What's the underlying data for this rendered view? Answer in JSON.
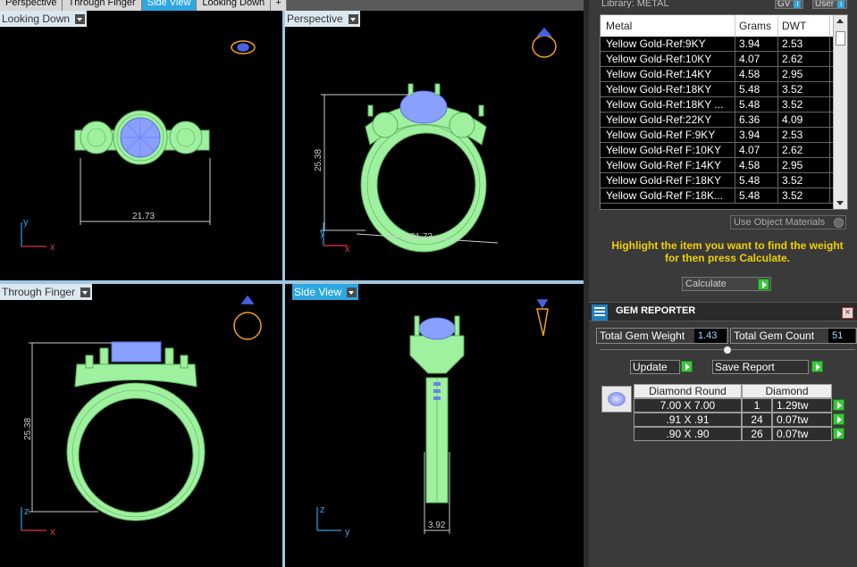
{
  "tabs": [
    {
      "label": "Perspective",
      "active": false
    },
    {
      "label": "Through Finger",
      "active": false
    },
    {
      "label": "Side View",
      "active": true
    },
    {
      "label": "Looking Down",
      "active": false
    },
    {
      "label": "+",
      "active": false
    }
  ],
  "viewports": {
    "top_left": {
      "label": "Looking Down",
      "dimension": "21.73",
      "axis_v": "y",
      "axis_h": "x"
    },
    "top_right": {
      "label": "Perspective",
      "dim_height": "25.38",
      "dim_width": "21.73",
      "axis_v": "y",
      "axis_h": "x"
    },
    "bottom_left": {
      "label": "Through Finger",
      "dimension": "25.38",
      "axis_v": "z",
      "axis_h": "x"
    },
    "bottom_right": {
      "label": "Side View",
      "dimension": "3.92",
      "axis_v": "z",
      "axis_h": "y"
    }
  },
  "panel": {
    "library_title": "Library: METAL",
    "gv_label": "GV",
    "user_label": "User",
    "metal_columns": [
      "Metal",
      "Grams",
      "DWT"
    ],
    "metal_rows": [
      {
        "metal": "Yellow Gold-Ref:9KY",
        "grams": "3.94",
        "dwt": "2.53"
      },
      {
        "metal": "Yellow Gold-Ref:10KY",
        "grams": "4.07",
        "dwt": "2.62"
      },
      {
        "metal": "Yellow Gold-Ref:14KY",
        "grams": "4.58",
        "dwt": "2.95"
      },
      {
        "metal": "Yellow Gold-Ref:18KY",
        "grams": "5.48",
        "dwt": "3.52"
      },
      {
        "metal": "Yellow Gold-Ref:18KY ...",
        "grams": "5.48",
        "dwt": "3.52"
      },
      {
        "metal": "Yellow Gold-Ref:22KY",
        "grams": "6.36",
        "dwt": "4.09"
      },
      {
        "metal": "Yellow Gold-Ref F:9KY",
        "grams": "3.94",
        "dwt": "2.53"
      },
      {
        "metal": "Yellow Gold-Ref F:10KY",
        "grams": "4.07",
        "dwt": "2.62"
      },
      {
        "metal": "Yellow Gold-Ref F:14KY",
        "grams": "4.58",
        "dwt": "2.95"
      },
      {
        "metal": "Yellow Gold-Ref F:18KY",
        "grams": "5.48",
        "dwt": "3.52"
      },
      {
        "metal": "Yellow Gold-Ref F:18K...",
        "grams": "5.48",
        "dwt": "3.52"
      }
    ],
    "use_object_materials": "Use Object Materials",
    "hint": "Highlight the item you want to find the weight for then press Calculate.",
    "calculate_label": "Calculate",
    "gem_reporter": {
      "title": "GEM REPORTER",
      "total_weight_label": "Total Gem Weight",
      "total_weight_value": "1.43",
      "total_count_label": "Total Gem Count",
      "total_count_value": "51",
      "update_label": "Update",
      "save_report_label": "Save Report",
      "gem_columns": [
        "Diamond Round",
        "Diamond"
      ],
      "gem_rows": [
        {
          "size": "7.00 X 7.00",
          "count": "1",
          "weight": "1.29tw"
        },
        {
          "size": ".91 X .91",
          "count": "24",
          "weight": "0.07tw"
        },
        {
          "size": ".90 X .90",
          "count": "26",
          "weight": "0.07tw"
        }
      ]
    }
  },
  "colors": {
    "metal": "#9ff09f",
    "stone": "#8aa0ff",
    "active_tab": "#2ea7e0",
    "hint_text": "#f0d000",
    "nav_icon": "#f0a020"
  }
}
